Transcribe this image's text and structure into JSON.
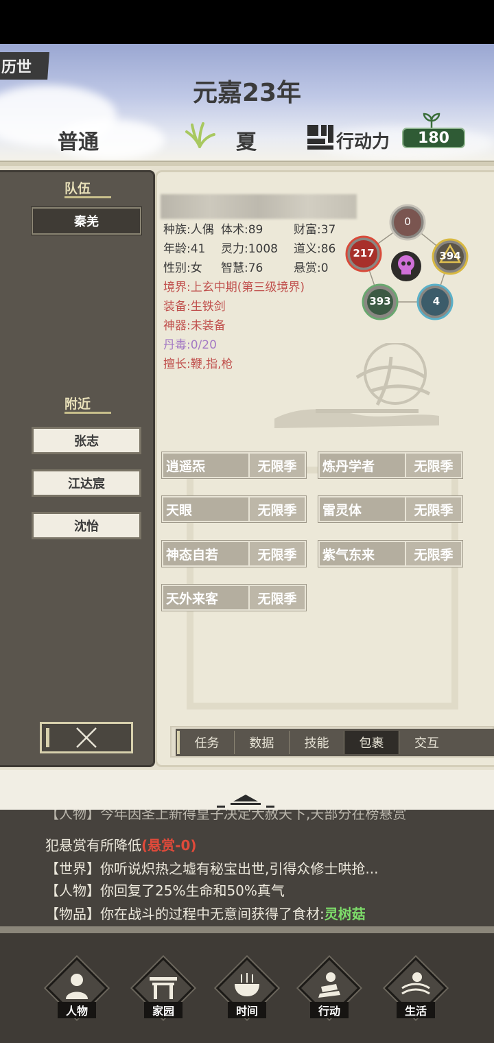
{
  "header": {
    "world_tag": "历世",
    "year": "元嘉23年",
    "difficulty": "普通",
    "season": "夏",
    "action_points_label": "行动力",
    "action_points": "180"
  },
  "team": {
    "title": "队伍",
    "members": [
      "秦羌"
    ]
  },
  "nearby": {
    "title": "附近",
    "people": [
      "张志",
      "江达宸",
      "沈怡"
    ]
  },
  "character": {
    "stats": {
      "race": "种族:人偶",
      "physique": "体术:89",
      "wealth": "财富:37",
      "age": "年龄:41",
      "spirit": "灵力:1008",
      "morality": "道义:86",
      "gender": "性别:女",
      "wisdom": "智慧:76",
      "bounty": "悬赏:0"
    },
    "realm": "境界:上玄中期(第三级境界)",
    "equipment": "装备:生铁剑",
    "artifact": "神器:未装备",
    "pill_poison": "丹毒:0/20",
    "expertise": "擅长:鞭,指,枪"
  },
  "elements": {
    "top": "0",
    "right": "394",
    "left": "217",
    "bottom_left": "393",
    "bottom_right": "4"
  },
  "traits": [
    {
      "name": "逍遥炁",
      "duration": "无限季"
    },
    {
      "name": "炼丹学者",
      "duration": "无限季"
    },
    {
      "name": "天眼",
      "duration": "无限季"
    },
    {
      "name": "雷灵体",
      "duration": "无限季"
    },
    {
      "name": "神态自若",
      "duration": "无限季"
    },
    {
      "name": "紫气东来",
      "duration": "无限季"
    },
    {
      "name": "天外来客",
      "duration": "无限季"
    }
  ],
  "tabs": [
    "任务",
    "数据",
    "技能",
    "包裹",
    "交互"
  ],
  "active_tab": "包裹",
  "log": {
    "line0": "【人物】今年因圣上新得皇子决定大赦天下,天部分在榜悬赏",
    "line1_text": "犯悬赏有所降低",
    "line1_hl": "(悬赏-0)",
    "line2": "【世界】你听说炽热之墟有秘宝出世,引得众修士哄抢...",
    "line3": "【人物】你回复了25%生命和50%真气",
    "line4_text": "【物品】你在战斗的过程中无意间获得了食材:",
    "line4_hl": "灵树菇"
  },
  "nav": [
    "人物",
    "家园",
    "时间",
    "行动",
    "生活"
  ],
  "colors": {
    "panel_dark": "#5a554d",
    "panel_light": "#ece8d8",
    "accent_green": "#2f5b35",
    "realm_red": "#c0504d",
    "poison_purple": "#a47ac4"
  }
}
